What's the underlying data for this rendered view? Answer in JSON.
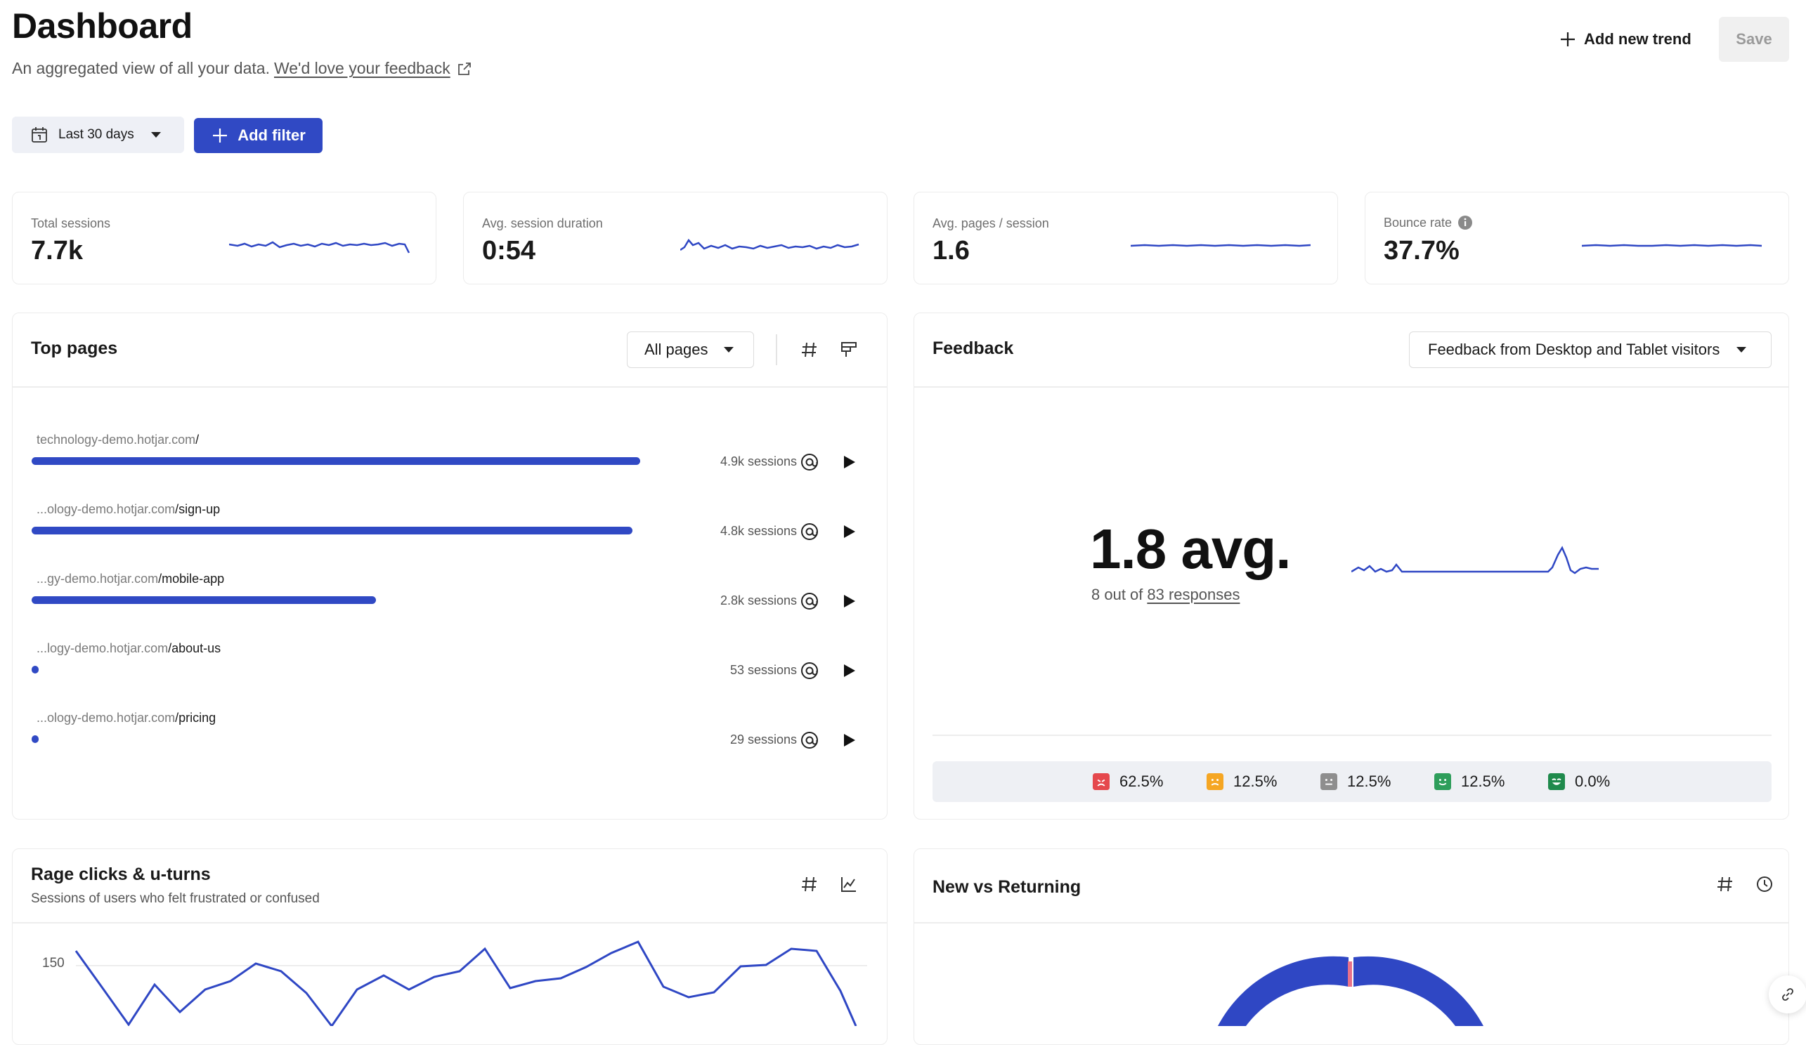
{
  "header": {
    "title": "Dashboard",
    "subtitle": "An aggregated view of all your data.",
    "feedback_link": "We'd love your feedback",
    "add_trend_label": "Add new trend",
    "save_label": "Save"
  },
  "filters": {
    "date_range": "Last 30 days",
    "add_filter_label": "Add filter"
  },
  "metrics": [
    {
      "label": "Total sessions",
      "value": "7.7k"
    },
    {
      "label": "Avg. session duration",
      "value": "0:54"
    },
    {
      "label": "Avg. pages / session",
      "value": "1.6"
    },
    {
      "label": "Bounce rate",
      "value": "37.7%"
    }
  ],
  "top_pages": {
    "title": "Top pages",
    "dropdown": "All pages",
    "rows": [
      {
        "domain": "technology-demo.hotjar.com",
        "path": "/",
        "sessions": "4.9k sessions",
        "fraction": 1.0
      },
      {
        "domain": "...ology-demo.hotjar.com",
        "path": "/sign-up",
        "sessions": "4.8k sessions",
        "fraction": 0.987
      },
      {
        "domain": "...gy-demo.hotjar.com",
        "path": "/mobile-app",
        "sessions": "2.8k sessions",
        "fraction": 0.566
      },
      {
        "domain": "...logy-demo.hotjar.com",
        "path": "/about-us",
        "sessions": "53 sessions",
        "fraction": 0.011
      },
      {
        "domain": "...ology-demo.hotjar.com",
        "path": "/pricing",
        "sessions": "29 sessions",
        "fraction": 0.006
      }
    ]
  },
  "feedback": {
    "title": "Feedback",
    "dropdown": "Feedback from Desktop and Tablet visitors",
    "avg": "1.8 avg.",
    "responses_prefix": "8 out of",
    "responses_link": "83 responses",
    "ratings": [
      {
        "value": "62.5%",
        "color": "#e5484d"
      },
      {
        "value": "12.5%",
        "color": "#f5a623"
      },
      {
        "value": "12.5%",
        "color": "#8e8e8e"
      },
      {
        "value": "12.5%",
        "color": "#2e9e5b"
      },
      {
        "value": "0.0%",
        "color": "#1f8a4c"
      }
    ]
  },
  "rage": {
    "title": "Rage clicks & u-turns",
    "subtitle": "Sessions of users who felt frustrated or confused",
    "y_tick": "150"
  },
  "new_returning": {
    "title": "New vs Returning"
  },
  "colors": {
    "accent": "#3049c4",
    "line": "#2f47c4"
  }
}
